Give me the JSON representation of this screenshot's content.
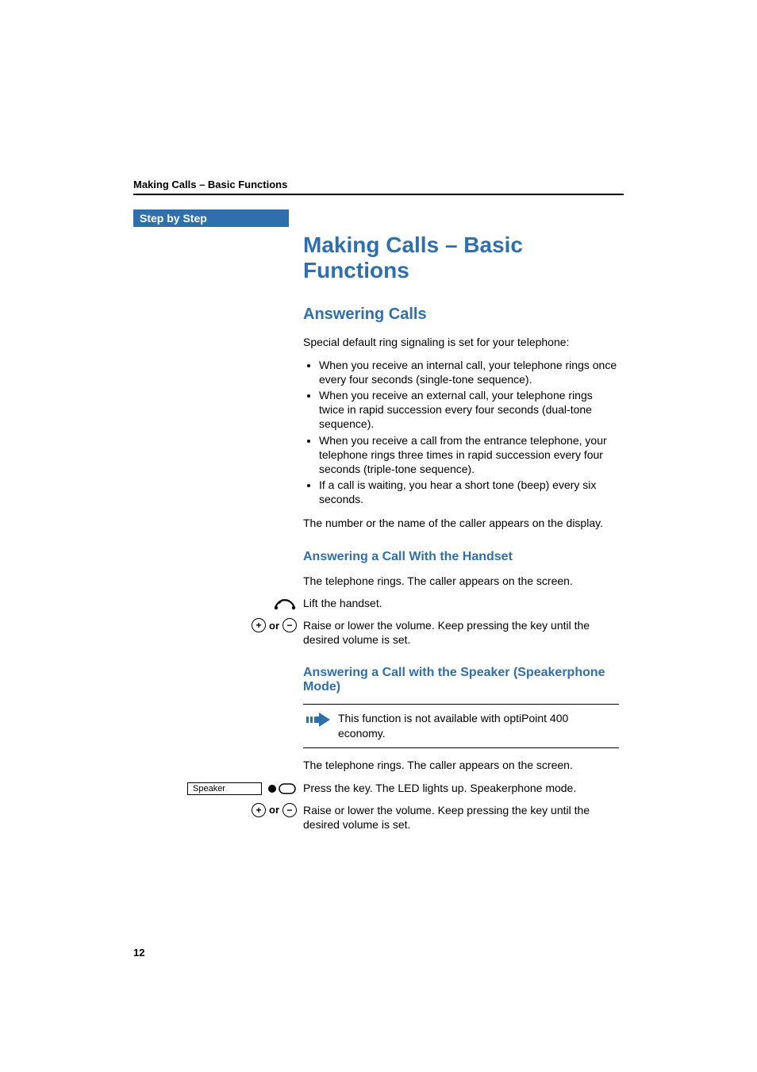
{
  "running_header": "Making Calls – Basic Functions",
  "sidebar_label": "Step by Step",
  "title": "Making Calls – Basic Functions",
  "answering": {
    "heading": "Answering Calls",
    "intro": "Special default ring signaling is set for your telephone:",
    "bullets": [
      "When you receive an internal call, your telephone rings once every four seconds (single-tone sequence).",
      "When you receive an external call, your telephone rings twice in rapid succession every four seconds (dual-tone sequence).",
      "When you receive a call from the entrance telephone, your telephone rings three times in rapid succession every four seconds (triple-tone sequence).",
      "If a call is waiting, you hear a short tone (beep) every six seconds."
    ],
    "after_bullets": "The number or the name of the caller appears on the display."
  },
  "handset": {
    "heading": "Answering a Call With the Handset",
    "line1": "The telephone rings. The caller appears on the screen.",
    "lift": "Lift the handset.",
    "volume": "Raise or lower the volume. Keep pressing the key until the desired volume is set."
  },
  "speaker": {
    "heading": "Answering a Call with the Speaker (Speakerphone Mode)",
    "note": "This function is not available with optiPoint 400 economy.",
    "line1": "The telephone rings. The caller appears on the screen.",
    "key_label": "Speaker",
    "press": "Press the key. The LED lights up. Speakerphone mode.",
    "volume": "Raise or lower the volume. Keep pressing the key until the desired volume is set."
  },
  "or_label": "or",
  "page_number": "12"
}
